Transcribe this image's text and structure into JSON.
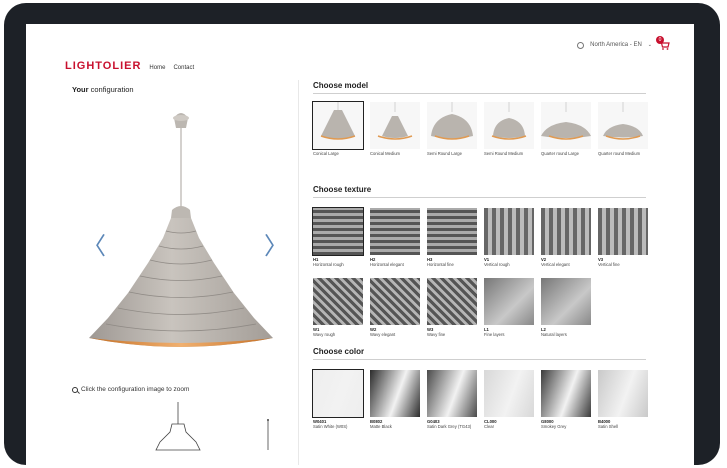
{
  "header": {
    "logo": "LIGHTOLIER",
    "nav": [
      "Home",
      "Contact"
    ],
    "region": "North America - EN",
    "cart_count": "0"
  },
  "left": {
    "title_bold": "Your",
    "title_rest": "configuration",
    "prev_arrow": "〈",
    "next_arrow": "〉",
    "zoom_hint": "Click the configuration image to zoom"
  },
  "sections": {
    "model": "Choose model",
    "texture": "Choose texture",
    "color": "Choose color"
  },
  "models": [
    {
      "name": "Conical Large",
      "selected": true
    },
    {
      "name": "Conical Medium",
      "selected": false
    },
    {
      "name": "Semi Round Large",
      "selected": false
    },
    {
      "name": "Semi Round Medium",
      "selected": false
    },
    {
      "name": "Quarter round Large",
      "selected": false
    },
    {
      "name": "Quarter round Medium",
      "selected": false
    }
  ],
  "textures": [
    {
      "code": "H1",
      "name": "Horizontal rough",
      "selected": true
    },
    {
      "code": "H2",
      "name": "Horizontal elegant",
      "selected": false
    },
    {
      "code": "H3",
      "name": "Horizontal fine",
      "selected": false
    },
    {
      "code": "V1",
      "name": "Vertical rough",
      "selected": false
    },
    {
      "code": "V2",
      "name": "Vertical elegant",
      "selected": false
    },
    {
      "code": "V3",
      "name": "Vertical fine",
      "selected": false
    },
    {
      "code": "W1",
      "name": "Wavy rough",
      "selected": false
    },
    {
      "code": "W2",
      "name": "Wavy elegant",
      "selected": false
    },
    {
      "code": "W3",
      "name": "Wavy fine",
      "selected": false
    },
    {
      "code": "L1",
      "name": "Fine layers",
      "selected": false
    },
    {
      "code": "L2",
      "name": "Natural layers",
      "selected": false
    }
  ],
  "colors": [
    {
      "code": "W0401",
      "name": "Satin White (W0S)",
      "selected": true,
      "swatch": "#eeeeee"
    },
    {
      "code": "B0802",
      "name": "Matte Black",
      "selected": false,
      "swatch": "#2b2b2b"
    },
    {
      "code": "G0403",
      "name": "Satin Dark Grey (TG43)",
      "selected": false,
      "swatch": "#4a4a4a"
    },
    {
      "code": "CL000",
      "name": "Clear",
      "selected": false,
      "swatch": "#d8d8d8"
    },
    {
      "code": "G8000",
      "name": "Smokey Grey",
      "selected": false,
      "swatch": "#3a3a3a"
    },
    {
      "code": "B4000",
      "name": "Satin Shell",
      "selected": false,
      "swatch": "#c9c9c9"
    }
  ],
  "colors_theme": {
    "brand": "#c8102e",
    "arrow": "#5c87b8",
    "shade": "#b5b0aa",
    "shade_inner": "#d98b3f"
  }
}
